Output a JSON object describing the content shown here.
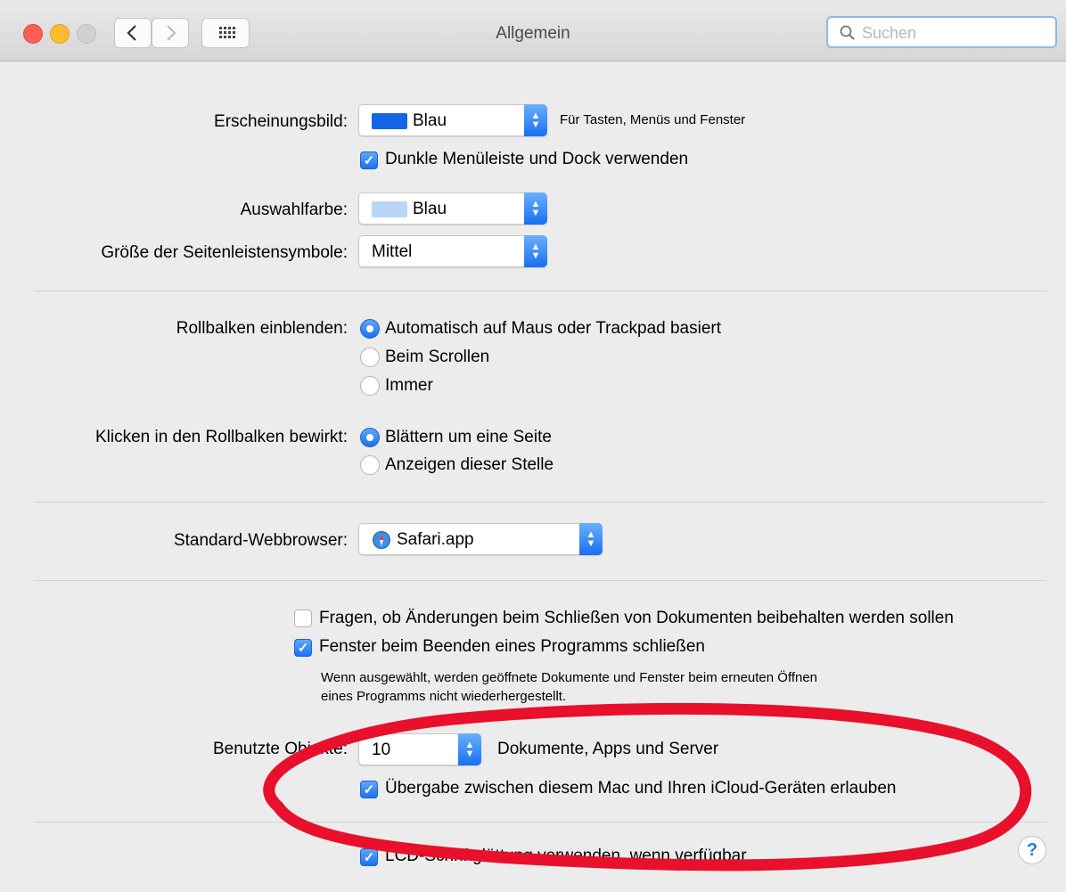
{
  "window": {
    "title": "Allgemein",
    "search_placeholder": "Suchen",
    "traffic_colors": {
      "close": "#fc5f57",
      "minimize": "#fdbc2e",
      "zoom": "#d0d0d0"
    }
  },
  "appearance": {
    "label": "Erscheinungsbild:",
    "value": "Blau",
    "hint": "Für Tasten, Menüs und Fenster",
    "swatch": "#1464e6"
  },
  "dark_menu": {
    "label": "Dunkle Menüleiste und Dock verwenden",
    "checked": true
  },
  "highlight": {
    "label": "Auswahlfarbe:",
    "value": "Blau",
    "swatch": "#b8d6f9"
  },
  "sidebar_size": {
    "label": "Größe der Seitenleistensymbole:",
    "value": "Mittel"
  },
  "scrollbars": {
    "label": "Rollbalken einblenden:",
    "options": [
      "Automatisch auf Maus oder Trackpad basiert",
      "Beim Scrollen",
      "Immer"
    ],
    "selected": 0
  },
  "click_scrollbar": {
    "label": "Klicken in den Rollbalken bewirkt:",
    "options": [
      "Blättern um eine Seite",
      "Anzeigen dieser Stelle"
    ],
    "selected": 0
  },
  "browser": {
    "label": "Standard-Webbrowser:",
    "value": "Safari.app"
  },
  "ask_keep_changes": {
    "label": "Fragen, ob Änderungen beim Schließen von Dokumenten beibehalten werden sollen",
    "checked": false
  },
  "close_windows": {
    "label": "Fenster beim Beenden eines Programms schließen",
    "checked": true,
    "note_line1": "Wenn ausgewählt, werden geöffnete Dokumente und Fenster beim erneuten Öffnen",
    "note_line2": "eines Programms nicht wiederhergestellt."
  },
  "recent_items": {
    "label": "Benutzte Objekte:",
    "value": "10",
    "suffix": "Dokumente, Apps und Server"
  },
  "handoff": {
    "label": "Übergabe zwischen diesem Mac und Ihren iCloud-Geräten erlauben",
    "checked": true
  },
  "lcd_smoothing": {
    "label": "LCD-Schriftglättung verwenden, wenn verfügbar",
    "checked": true
  },
  "annotation": {
    "color": "#e8102a"
  },
  "help_glyph": "?"
}
